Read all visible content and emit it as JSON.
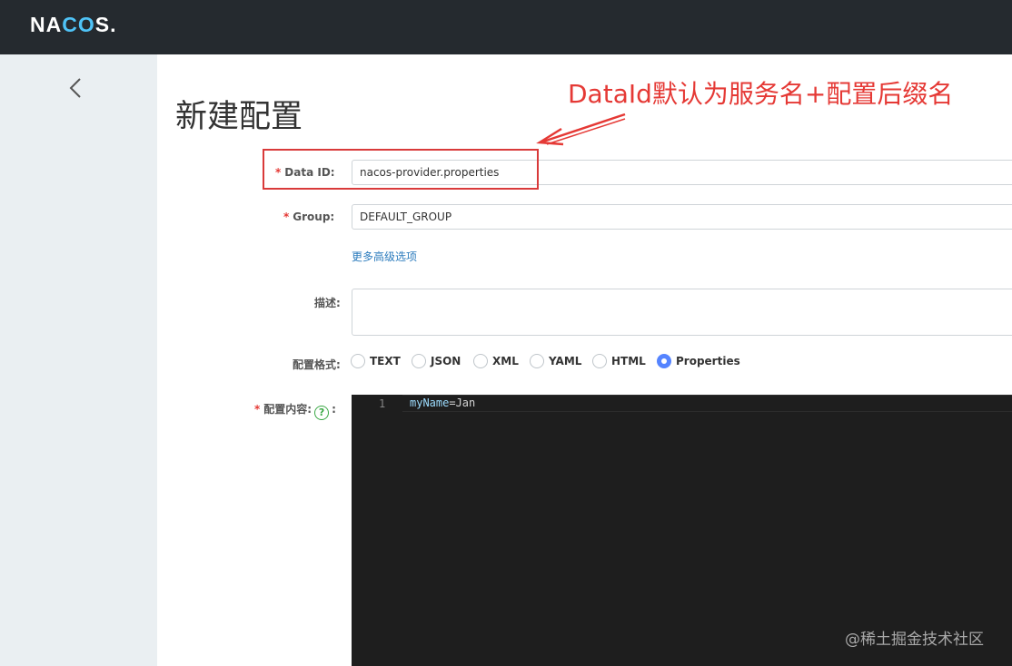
{
  "header": {
    "logo_text_a": "NA",
    "logo_text_b": "CO",
    "logo_text_c": "S."
  },
  "sidebar": {
    "back_icon": "chevron-left-icon"
  },
  "page": {
    "title": "新建配置"
  },
  "annotation": {
    "text": "DataId默认为服务名+配置后缀名",
    "color": "#e53935"
  },
  "form": {
    "data_id": {
      "required_mark": "*",
      "label": "Data ID:",
      "value": "nacos-provider.properties"
    },
    "group": {
      "required_mark": "*",
      "label": "Group:",
      "value": "DEFAULT_GROUP"
    },
    "advanced_link": "更多高级选项",
    "description": {
      "label": "描述:",
      "value": ""
    },
    "format": {
      "label": "配置格式:",
      "options": [
        "TEXT",
        "JSON",
        "XML",
        "YAML",
        "HTML",
        "Properties"
      ],
      "selected": "Properties"
    },
    "content": {
      "required_mark": "*",
      "label": "配置内容:",
      "help_icon": "question-circle-icon",
      "colon": ":",
      "line_number": "1",
      "code_key": "myName",
      "code_rest": "=Jan"
    }
  },
  "watermark": "@稀土掘金技术社区"
}
